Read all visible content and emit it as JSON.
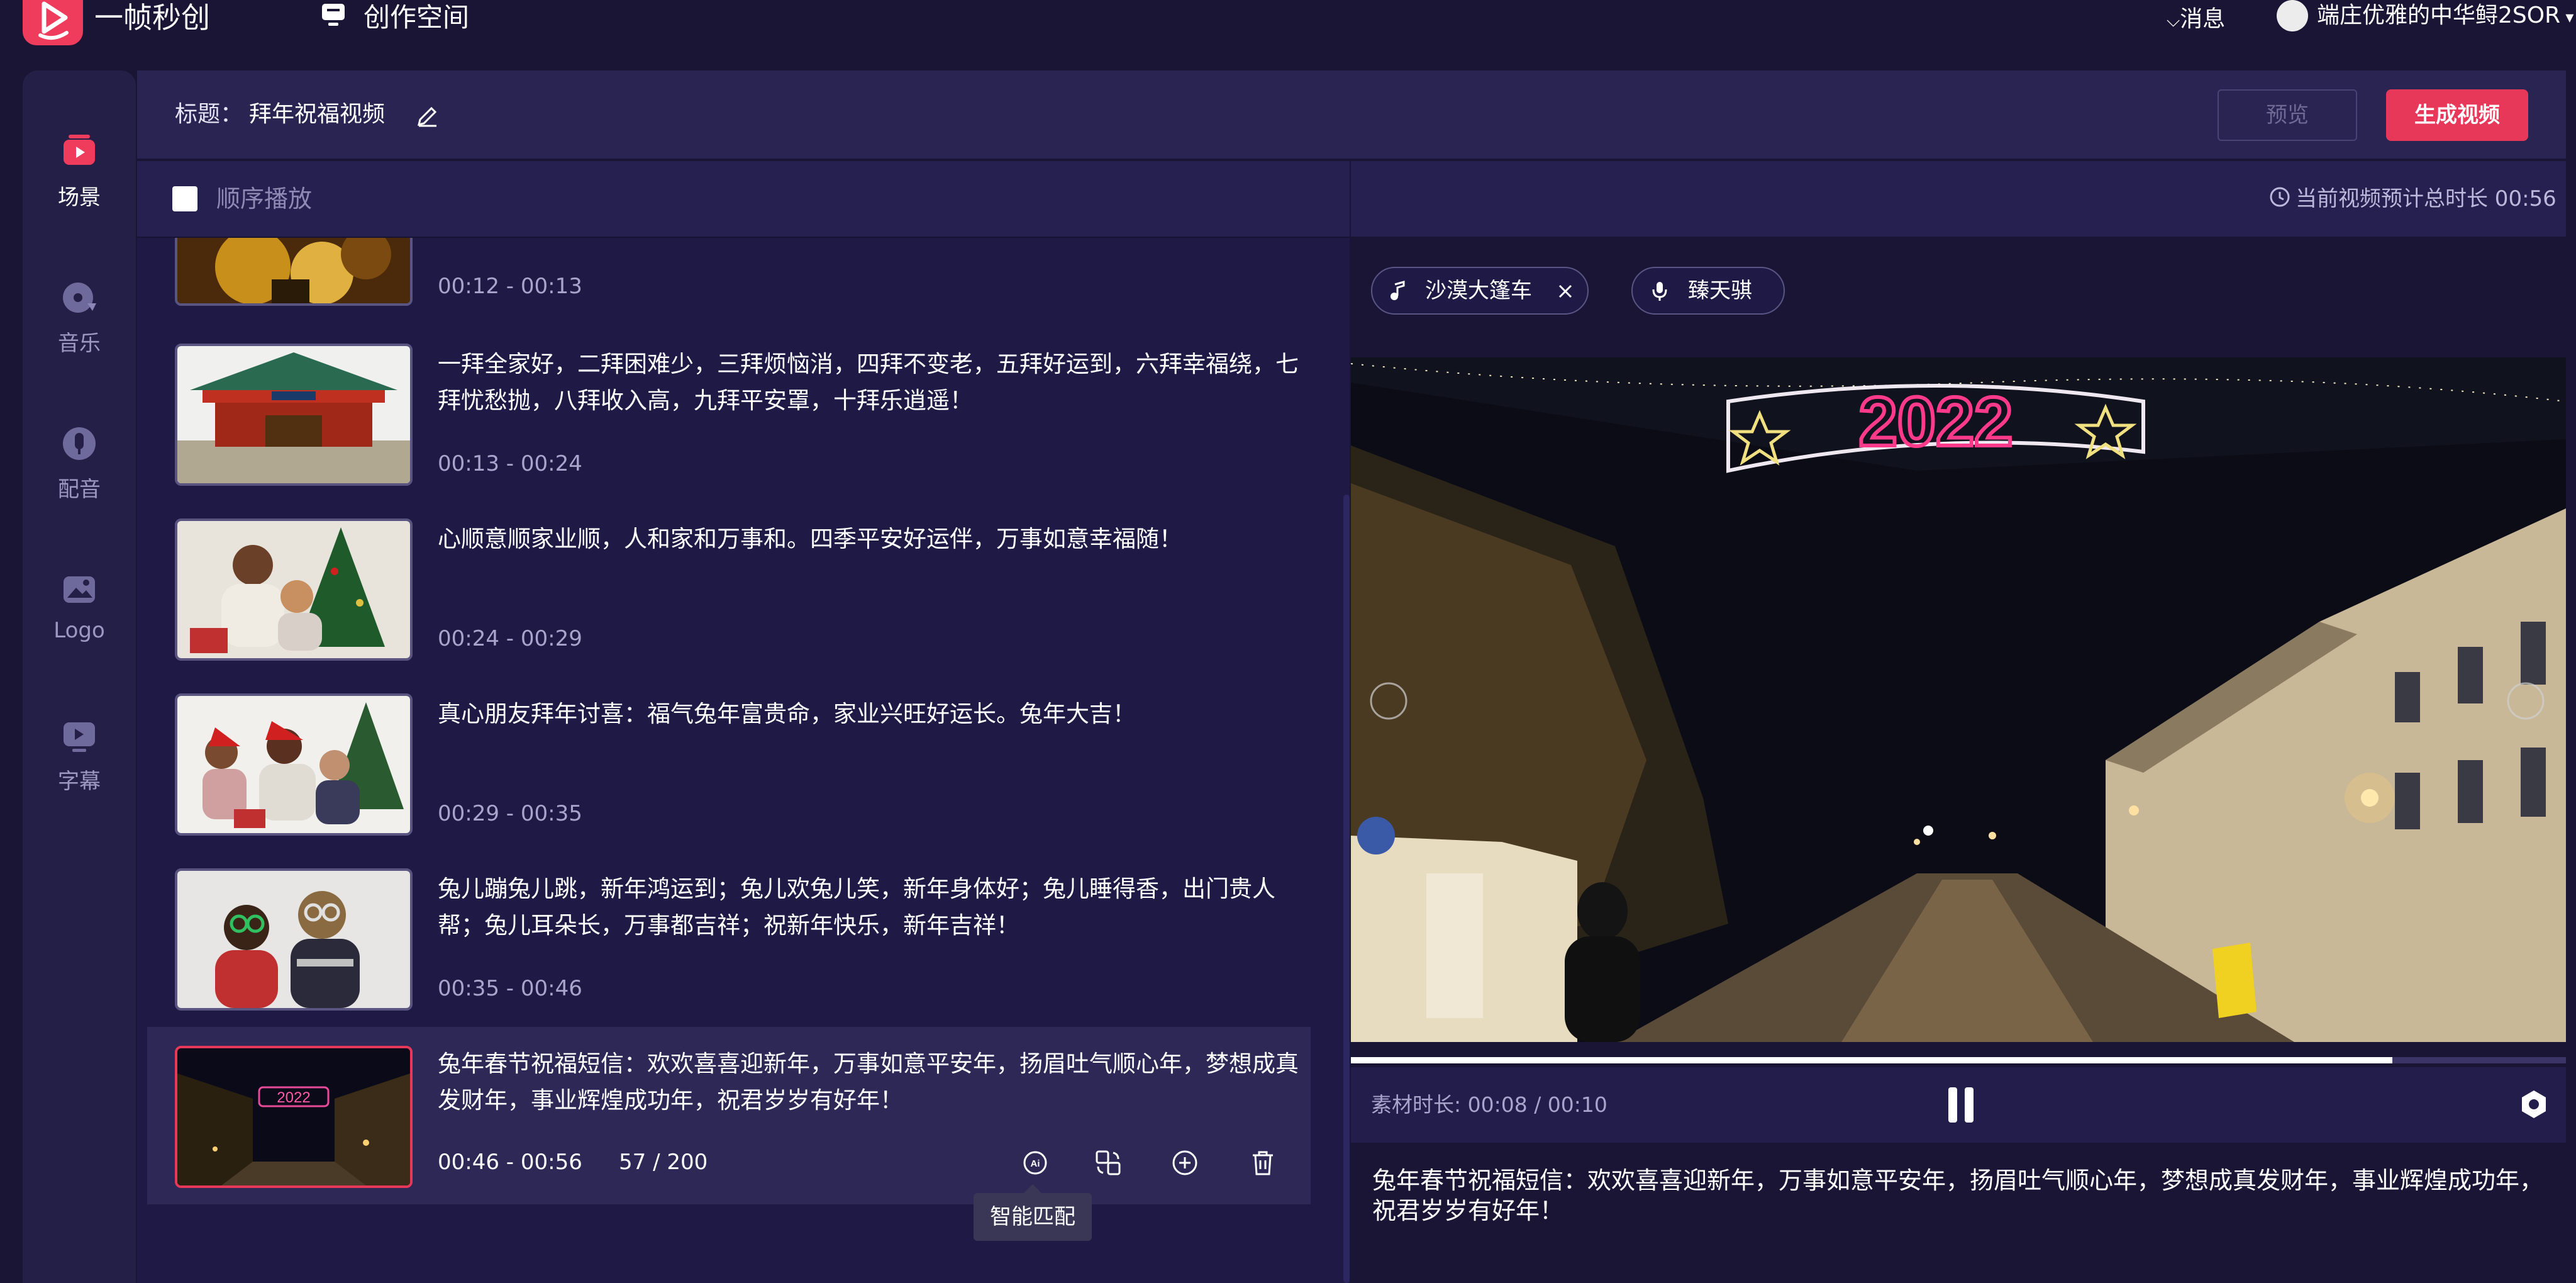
{
  "topbar": {
    "logo_text": "一帧秒创",
    "workspace_label": "创作空间",
    "messages_label": "消息",
    "username": "端庄优雅的中华鲟2SOR"
  },
  "sidebar": {
    "items": [
      {
        "label": "场景",
        "icon": "scene-icon",
        "active": true
      },
      {
        "label": "音乐",
        "icon": "music-icon"
      },
      {
        "label": "配音",
        "icon": "voice-icon"
      },
      {
        "label": "Logo",
        "icon": "logo-icon"
      },
      {
        "label": "字幕",
        "icon": "subtitle-icon"
      }
    ]
  },
  "header": {
    "title_label": "标题：",
    "title_value": "拜年祝福视频",
    "preview_label": "预览",
    "generate_label": "生成视频"
  },
  "list": {
    "sequential_play_label": "顺序播放",
    "scenes": [
      {
        "text": "",
        "time": "00:12 - 00:13"
      },
      {
        "text": "一拜全家好，二拜困难少，三拜烦恼消，四拜不变老，五拜好运到，六拜幸福绕，七拜忧愁抛，八拜收入高，九拜平安罩，十拜乐逍遥！",
        "time": "00:13 - 00:24"
      },
      {
        "text": "心顺意顺家业顺，人和家和万事和。四季平安好运伴，万事如意幸福随！",
        "time": "00:24 - 00:29"
      },
      {
        "text": "真心朋友拜年讨喜：福气兔年富贵命，家业兴旺好运长。兔年大吉！",
        "time": "00:29 - 00:35"
      },
      {
        "text": "兔儿蹦兔儿跳，新年鸿运到；兔儿欢兔儿笑，新年身体好；兔儿睡得香，出门贵人帮；兔儿耳朵长，万事都吉祥；祝新年快乐，新年吉祥！",
        "time": "00:35 - 00:46"
      },
      {
        "text": "兔年春节祝福短信：欢欢喜喜迎新年，万事如意平安年，扬眉吐气顺心年，梦想成真发财年，事业辉煌成功年，祝君岁岁有好年！",
        "time": "00:46 - 00:56",
        "count": "57 / 200",
        "active": true
      }
    ],
    "tooltip": "智能匹配",
    "thumb_sign": "2022"
  },
  "preview": {
    "total_duration_label": "当前视频预计总时长 00:56",
    "music_tag": "沙漠大篷车",
    "voice_tag": "臻天骐",
    "video_sign_text": "2022",
    "progress": 0.857,
    "material_duration": "素材时长: 00:08 / 00:10",
    "caption": "兔年春节祝福短信：欢欢喜喜迎新年，万事如意平安年，扬眉吐气顺心年，梦想成真发财年，事业辉煌成功年，祝君岁岁有好年！"
  },
  "colors": {
    "accent": "#e8385a",
    "background": "#1a1535",
    "panel": "#1f1a45"
  }
}
